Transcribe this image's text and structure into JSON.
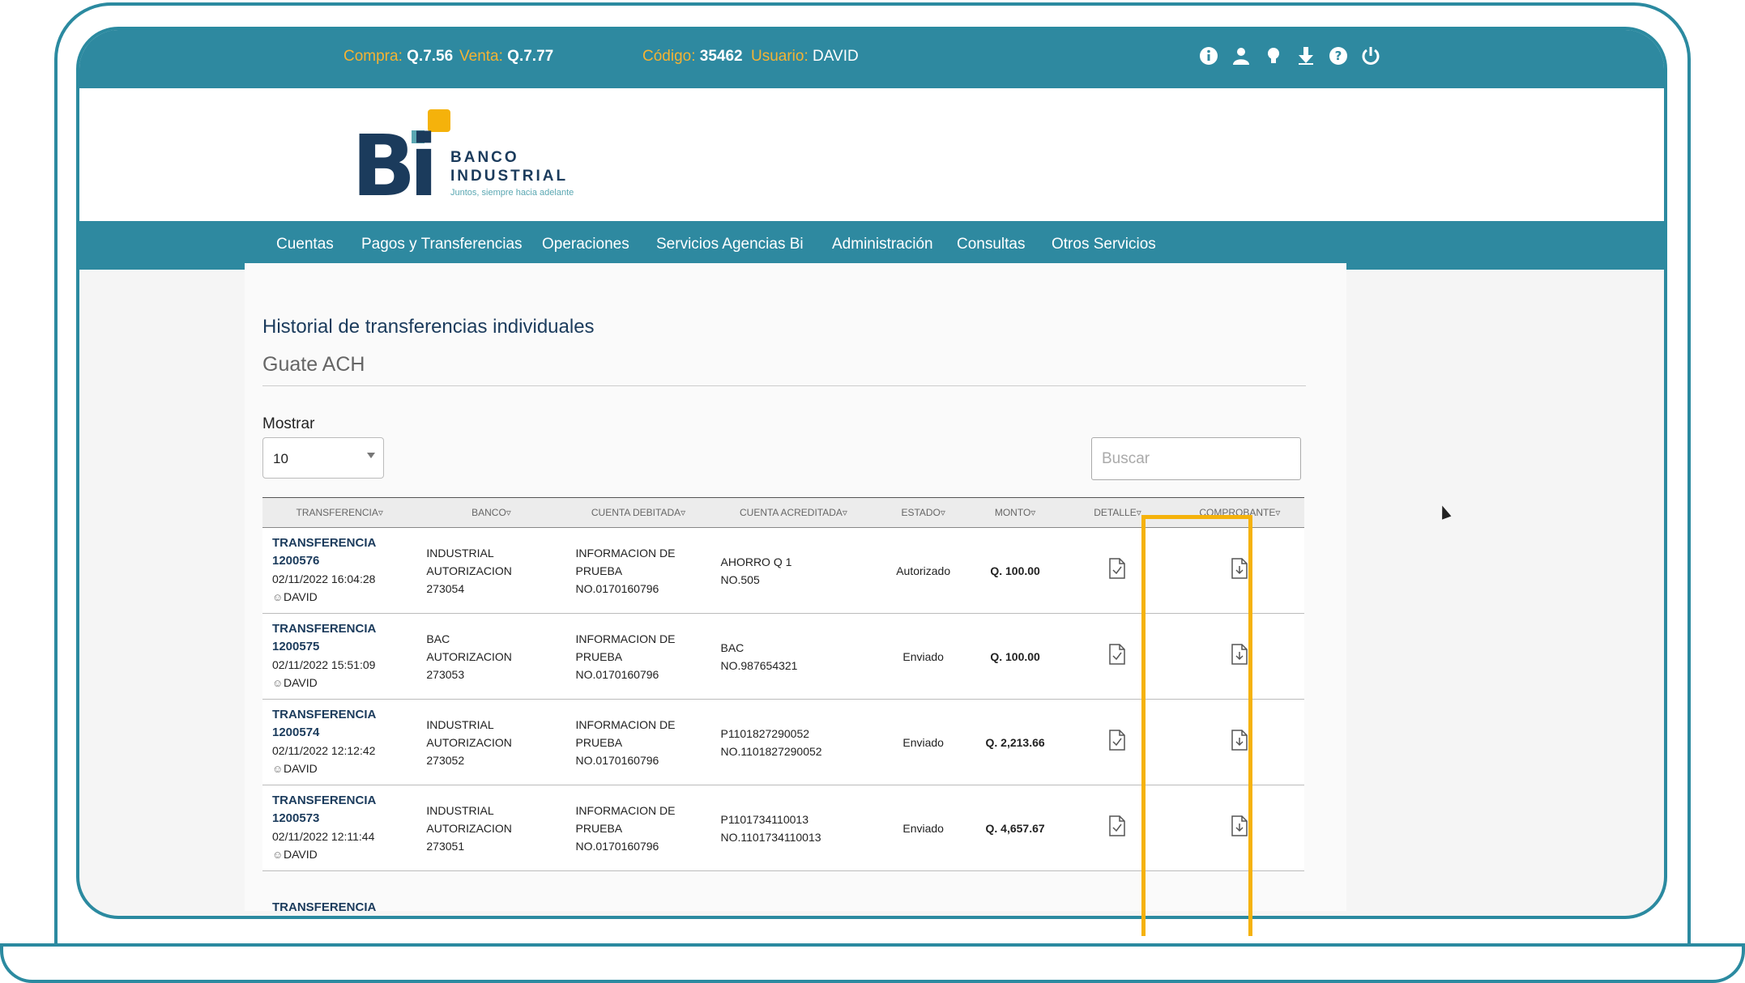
{
  "topbar": {
    "compra_label": "Compra:",
    "compra_value": "Q.7.56",
    "venta_label": "Venta:",
    "venta_value": "Q.7.77",
    "codigo_label": "Código:",
    "codigo_value": "35462",
    "usuario_label": "Usuario:",
    "usuario_value": "DAVID",
    "icons": [
      "info-icon",
      "user-icon",
      "lightbulb-icon",
      "download-icon",
      "help-icon",
      "power-icon"
    ]
  },
  "logo": {
    "mark": "Bi",
    "name_line1": "BANCO",
    "name_line2": "INDUSTRIAL",
    "tagline": "Juntos, siempre hacia adelante"
  },
  "nav": {
    "items": [
      "Cuentas",
      "Pagos y Transferencias",
      "Operaciones",
      "Servicios Agencias Bi",
      "Administración",
      "Consultas",
      "Otros Servicios"
    ]
  },
  "page": {
    "title": "Historial de transferencias individuales",
    "subtitle": "Guate ACH",
    "mostrar_label": "Mostrar",
    "mostrar_value": "10",
    "search_placeholder": "Buscar"
  },
  "table": {
    "headers": [
      "TRANSFERENCIA",
      "BANCO",
      "CUENTA DEBITADA",
      "CUENTA ACREDITADA",
      "ESTADO",
      "MONTO",
      "DETALLE",
      "COMPROBANTE"
    ],
    "rows": [
      {
        "t1": "TRANSFERENCIA",
        "t2": "1200576",
        "date": "02/11/2022 16:04:28",
        "user": "DAVID",
        "banco": [
          "INDUSTRIAL",
          "AUTORIZACION",
          "273054"
        ],
        "debitada": [
          "INFORMACION DE",
          "PRUEBA",
          "NO.0170160796"
        ],
        "acreditada": [
          "AHORRO Q 1",
          "NO.505"
        ],
        "estado": "Autorizado",
        "monto": "Q. 100.00"
      },
      {
        "t1": "TRANSFERENCIA",
        "t2": "1200575",
        "date": "02/11/2022 15:51:09",
        "user": "DAVID",
        "banco": [
          "BAC",
          "AUTORIZACION",
          "273053"
        ],
        "debitada": [
          "INFORMACION DE",
          "PRUEBA",
          "NO.0170160796"
        ],
        "acreditada": [
          "BAC",
          "NO.987654321"
        ],
        "estado": "Enviado",
        "monto": "Q. 100.00"
      },
      {
        "t1": "TRANSFERENCIA",
        "t2": "1200574",
        "date": "02/11/2022 12:12:42",
        "user": "DAVID",
        "banco": [
          "INDUSTRIAL",
          "AUTORIZACION",
          "273052"
        ],
        "debitada": [
          "INFORMACION DE",
          "PRUEBA",
          "NO.0170160796"
        ],
        "acreditada": [
          "P1101827290052",
          "NO.1101827290052"
        ],
        "estado": "Enviado",
        "monto": "Q. 2,213.66"
      },
      {
        "t1": "TRANSFERENCIA",
        "t2": "1200573",
        "date": "02/11/2022 12:11:44",
        "user": "DAVID",
        "banco": [
          "INDUSTRIAL",
          "AUTORIZACION",
          "273051"
        ],
        "debitada": [
          "INFORMACION DE",
          "PRUEBA",
          "NO.0170160796"
        ],
        "acreditada": [
          "P1101734110013",
          "NO.1101734110013"
        ],
        "estado": "Enviado",
        "monto": "Q. 4,657.67"
      }
    ],
    "partial_row_label": "TRANSFERENCIA"
  },
  "colors": {
    "brand_teal": "#2e89a0",
    "brand_navy": "#1b3b5c",
    "accent_yellow": "#f5b20b",
    "label_orange": "#f5b333"
  }
}
